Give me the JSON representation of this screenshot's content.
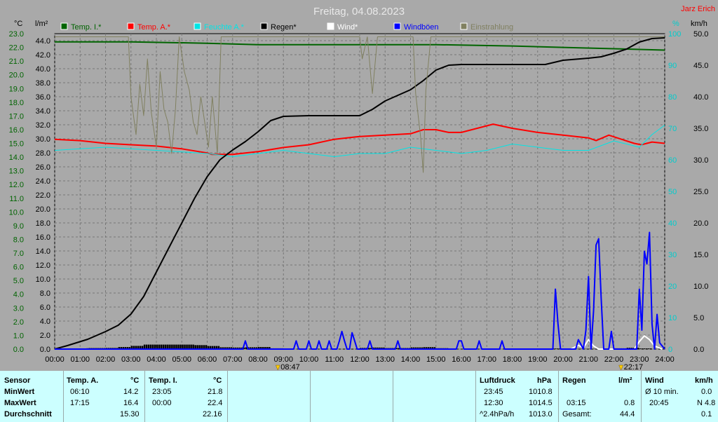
{
  "title": "Freitag, 04.08.2023",
  "author": "Jarz Erich",
  "units": {
    "left_temp": "°C",
    "left_rain": "l/m²",
    "right_hum": "%",
    "right_wind": "km/h"
  },
  "legend": [
    {
      "label": "Temp. I.*",
      "color": "#006400"
    },
    {
      "label": "Temp. A.*",
      "color": "#ff0000"
    },
    {
      "label": "Feuchte A.*",
      "color": "#00e5e5"
    },
    {
      "label": "Regen*",
      "color": "#000000"
    },
    {
      "label": "Wind*",
      "color": "#ffffff"
    },
    {
      "label": "Windböen",
      "color": "#0000ff"
    },
    {
      "label": "Einstrahlung",
      "color": "#808060"
    }
  ],
  "markers": [
    {
      "label": "08:47",
      "time": 8.78
    },
    {
      "label": "22:17",
      "time": 22.28
    }
  ],
  "chart_data": {
    "type": "line",
    "title": "Freitag, 04.08.2023",
    "x_ticks": [
      "00:00",
      "01:00",
      "02:00",
      "03:00",
      "04:00",
      "05:00",
      "06:00",
      "07:00",
      "08:00",
      "09:00",
      "10:00",
      "11:00",
      "12:00",
      "13:00",
      "14:00",
      "15:00",
      "16:00",
      "17:00",
      "18:00",
      "19:00",
      "20:00",
      "21:00",
      "22:00",
      "23:00",
      "24:00"
    ],
    "xlim": [
      0,
      24
    ],
    "axes": {
      "temp": {
        "label": "°C",
        "lim": [
          0,
          23
        ],
        "ticks": [
          "0.0",
          "1.0",
          "2.0",
          "3.0",
          "4.0",
          "5.0",
          "6.0",
          "7.0",
          "8.0",
          "9.0",
          "10.0",
          "11.0",
          "12.0",
          "13.0",
          "14.0",
          "15.0",
          "16.0",
          "17.0",
          "18.0",
          "19.0",
          "20.0",
          "21.0",
          "22.0",
          "23.0"
        ]
      },
      "rain": {
        "label": "l/m²",
        "lim": [
          0,
          45
        ],
        "ticks": [
          "0.0",
          "2.0",
          "4.0",
          "6.0",
          "8.0",
          "10.0",
          "12.0",
          "14.0",
          "16.0",
          "18.0",
          "20.0",
          "22.0",
          "24.0",
          "26.0",
          "28.0",
          "30.0",
          "32.0",
          "34.0",
          "36.0",
          "38.0",
          "40.0",
          "42.0",
          "44.0"
        ]
      },
      "hum": {
        "label": "%",
        "lim": [
          0,
          100
        ],
        "ticks": [
          "0",
          "10",
          "20",
          "30",
          "40",
          "50",
          "60",
          "70",
          "80",
          "90",
          "100"
        ]
      },
      "wind": {
        "label": "km/h",
        "lim": [
          0,
          50
        ],
        "ticks": [
          "0.0",
          "5.0",
          "10.0",
          "15.0",
          "20.0",
          "25.0",
          "30.0",
          "35.0",
          "40.0",
          "45.0",
          "50.0"
        ]
      }
    },
    "series": [
      {
        "name": "Temp. I.*",
        "axis": "temp",
        "color": "#006400",
        "width": 2,
        "points": [
          [
            0,
            22.4
          ],
          [
            3,
            22.4
          ],
          [
            6,
            22.3
          ],
          [
            8,
            22.2
          ],
          [
            12,
            22.2
          ],
          [
            15,
            22.2
          ],
          [
            18,
            22.1
          ],
          [
            20,
            22.0
          ],
          [
            22,
            21.9
          ],
          [
            24,
            21.8
          ]
        ]
      },
      {
        "name": "Temp. A.*",
        "axis": "temp",
        "color": "#ff0000",
        "width": 2,
        "points": [
          [
            0,
            15.3
          ],
          [
            1,
            15.2
          ],
          [
            2,
            15.0
          ],
          [
            3,
            14.9
          ],
          [
            4,
            14.8
          ],
          [
            5,
            14.6
          ],
          [
            6,
            14.3
          ],
          [
            6.17,
            14.2
          ],
          [
            7,
            14.2
          ],
          [
            8,
            14.4
          ],
          [
            9,
            14.7
          ],
          [
            10,
            14.9
          ],
          [
            11,
            15.3
          ],
          [
            12,
            15.5
          ],
          [
            13,
            15.6
          ],
          [
            14,
            15.7
          ],
          [
            14.5,
            16.0
          ],
          [
            15,
            16.0
          ],
          [
            15.5,
            15.8
          ],
          [
            16,
            15.8
          ],
          [
            17.25,
            16.4
          ],
          [
            18,
            16.1
          ],
          [
            19,
            15.8
          ],
          [
            20,
            15.6
          ],
          [
            20.5,
            15.5
          ],
          [
            21,
            15.4
          ],
          [
            21.3,
            15.2
          ],
          [
            21.8,
            15.6
          ],
          [
            22.3,
            15.3
          ],
          [
            22.8,
            15.0
          ],
          [
            23.08,
            14.9
          ],
          [
            23.5,
            15.1
          ],
          [
            24,
            15.0
          ]
        ]
      },
      {
        "name": "Feuchte A.*",
        "axis": "hum",
        "color": "#00e5e5",
        "width": 1,
        "points": [
          [
            0,
            63
          ],
          [
            2,
            64
          ],
          [
            4,
            63
          ],
          [
            6,
            62
          ],
          [
            7,
            61
          ],
          [
            8,
            62
          ],
          [
            9,
            63
          ],
          [
            10,
            62
          ],
          [
            11,
            61
          ],
          [
            12,
            62
          ],
          [
            13,
            62
          ],
          [
            14,
            64
          ],
          [
            15,
            63
          ],
          [
            16,
            62
          ],
          [
            17,
            63
          ],
          [
            18,
            65
          ],
          [
            19,
            64
          ],
          [
            20,
            63
          ],
          [
            21,
            63
          ],
          [
            22,
            66
          ],
          [
            23,
            64
          ],
          [
            23.5,
            68
          ],
          [
            24,
            71
          ]
        ]
      },
      {
        "name": "Regen*",
        "axis": "rain",
        "color": "#000000",
        "width": 2,
        "points": [
          [
            0,
            0
          ],
          [
            0.5,
            0.5
          ],
          [
            1.3,
            1.4
          ],
          [
            2,
            2.5
          ],
          [
            2.5,
            3.4
          ],
          [
            3,
            5
          ],
          [
            3.5,
            7.5
          ],
          [
            4,
            11
          ],
          [
            4.5,
            14.5
          ],
          [
            5,
            18
          ],
          [
            5.5,
            21.5
          ],
          [
            6,
            24.6
          ],
          [
            6.5,
            27
          ],
          [
            7,
            28.4
          ],
          [
            7.5,
            29.6
          ],
          [
            8,
            31
          ],
          [
            8.5,
            32.6
          ],
          [
            9,
            33.2
          ],
          [
            10,
            33.3
          ],
          [
            11,
            33.3
          ],
          [
            12,
            33.3
          ],
          [
            12.5,
            34.2
          ],
          [
            13,
            35.4
          ],
          [
            13.5,
            36.2
          ],
          [
            14,
            37
          ],
          [
            14.5,
            38.3
          ],
          [
            15,
            39.8
          ],
          [
            15.5,
            40.5
          ],
          [
            16,
            40.6
          ],
          [
            18,
            40.6
          ],
          [
            19.3,
            40.6
          ],
          [
            20,
            41.2
          ],
          [
            21,
            41.5
          ],
          [
            21.5,
            41.7
          ],
          [
            22,
            42.2
          ],
          [
            22.5,
            42.8
          ],
          [
            23,
            43.8
          ],
          [
            23.5,
            44.3
          ],
          [
            24,
            44.4
          ]
        ]
      },
      {
        "name": "Wind*",
        "axis": "wind",
        "color": "#ffffff",
        "width": 2,
        "points": [
          [
            20.3,
            0
          ],
          [
            20.6,
            0.6
          ],
          [
            20.8,
            0.2
          ],
          [
            21.0,
            1.5
          ],
          [
            21.2,
            0.5
          ],
          [
            21.4,
            0
          ],
          [
            22.8,
            0
          ],
          [
            23.0,
            1.2
          ],
          [
            23.2,
            2.1
          ],
          [
            23.4,
            1.5
          ],
          [
            23.6,
            0.5
          ],
          [
            23.9,
            0
          ]
        ]
      },
      {
        "name": "Windböen",
        "axis": "wind",
        "color": "#0000ff",
        "width": 2,
        "points": [
          [
            0,
            0
          ],
          [
            7.4,
            0
          ],
          [
            7.5,
            1.3
          ],
          [
            7.6,
            0
          ],
          [
            9.4,
            0
          ],
          [
            9.5,
            1.3
          ],
          [
            9.6,
            0
          ],
          [
            9.9,
            0
          ],
          [
            10,
            1.3
          ],
          [
            10.1,
            0
          ],
          [
            10.3,
            0
          ],
          [
            10.4,
            1.3
          ],
          [
            10.5,
            0
          ],
          [
            10.7,
            0
          ],
          [
            10.8,
            1.3
          ],
          [
            10.9,
            0
          ],
          [
            11.1,
            0
          ],
          [
            11.2,
            1.3
          ],
          [
            11.3,
            2.8
          ],
          [
            11.4,
            1.3
          ],
          [
            11.5,
            0
          ],
          [
            11.6,
            0
          ],
          [
            11.7,
            2.6
          ],
          [
            11.8,
            1.3
          ],
          [
            11.9,
            0
          ],
          [
            12.3,
            0
          ],
          [
            12.4,
            1.3
          ],
          [
            12.5,
            0
          ],
          [
            13.4,
            0
          ],
          [
            13.5,
            1.3
          ],
          [
            13.6,
            0
          ],
          [
            15.8,
            0
          ],
          [
            15.9,
            1.3
          ],
          [
            16.0,
            1.3
          ],
          [
            16.1,
            0
          ],
          [
            16.6,
            0
          ],
          [
            16.7,
            1.3
          ],
          [
            16.8,
            0
          ],
          [
            17.5,
            0
          ],
          [
            17.6,
            1.3
          ],
          [
            17.7,
            0
          ],
          [
            19.6,
            0
          ],
          [
            19.7,
            9.5
          ],
          [
            19.8,
            4
          ],
          [
            19.9,
            0
          ],
          [
            20.5,
            0
          ],
          [
            20.6,
            1.5
          ],
          [
            20.8,
            0
          ],
          [
            20.9,
            3
          ],
          [
            21.0,
            11.5
          ],
          [
            21.1,
            0
          ],
          [
            21.2,
            6
          ],
          [
            21.3,
            16.5
          ],
          [
            21.4,
            17.5
          ],
          [
            21.5,
            8
          ],
          [
            21.6,
            0
          ],
          [
            21.8,
            0
          ],
          [
            21.9,
            2.8
          ],
          [
            22.0,
            0
          ],
          [
            22.9,
            0
          ],
          [
            23.0,
            9.5
          ],
          [
            23.1,
            3
          ],
          [
            23.2,
            15.5
          ],
          [
            23.3,
            13.5
          ],
          [
            23.4,
            18.5
          ],
          [
            23.5,
            4
          ],
          [
            23.6,
            0
          ],
          [
            23.7,
            5.5
          ],
          [
            23.8,
            1
          ],
          [
            24,
            0
          ]
        ]
      },
      {
        "name": "Einstrahlung",
        "axis": "hum",
        "color": "#808060",
        "width": 1,
        "points": [
          [
            0,
            99
          ],
          [
            2,
            99
          ],
          [
            2.9,
            99
          ],
          [
            3,
            80
          ],
          [
            3.2,
            68
          ],
          [
            3.35,
            84
          ],
          [
            3.5,
            74
          ],
          [
            3.65,
            92
          ],
          [
            3.8,
            75
          ],
          [
            4,
            64
          ],
          [
            4.15,
            88
          ],
          [
            4.3,
            76
          ],
          [
            4.45,
            72
          ],
          [
            4.6,
            62
          ],
          [
            4.75,
            76
          ],
          [
            4.9,
            99
          ],
          [
            5.1,
            88
          ],
          [
            5.3,
            82
          ],
          [
            5.45,
            72
          ],
          [
            5.6,
            68
          ],
          [
            5.75,
            80
          ],
          [
            5.9,
            72
          ],
          [
            6.05,
            64
          ],
          [
            6.2,
            80
          ],
          [
            6.4,
            62
          ],
          [
            6.55,
            99
          ],
          [
            6.7,
            99
          ],
          [
            12,
            99
          ],
          [
            12.1,
            92
          ],
          [
            12.3,
            99
          ],
          [
            12.5,
            81
          ],
          [
            12.7,
            99
          ],
          [
            13,
            99
          ],
          [
            14.1,
            99
          ],
          [
            14.2,
            81
          ],
          [
            14.4,
            67
          ],
          [
            14.5,
            56
          ],
          [
            14.6,
            82
          ],
          [
            14.8,
            99
          ],
          [
            16,
            99
          ],
          [
            18,
            99
          ],
          [
            22,
            99
          ],
          [
            24,
            99
          ]
        ]
      }
    ],
    "rain_bars_axis": "rain"
  },
  "stats": {
    "headers": {
      "sensor": "Sensor",
      "temp_a": "Temp. A.",
      "temp_a_unit": "°C",
      "temp_i": "Temp. I.",
      "temp_i_unit": "°C",
      "pressure": "Luftdruck",
      "pressure_unit": "hPa",
      "rain": "Regen",
      "rain_unit": "l/m²",
      "wind": "Wind",
      "wind_unit": "km/h"
    },
    "rows": {
      "min": "MinWert",
      "max": "MaxWert",
      "avg": "Durchschnitt"
    },
    "temp_a": {
      "min_time": "06:10",
      "min_val": "14.2",
      "max_time": "17:15",
      "max_val": "16.4",
      "avg": "15.30"
    },
    "temp_i": {
      "min_time": "23:05",
      "min_val": "21.8",
      "max_time": "00:00",
      "max_val": "22.4",
      "avg": "22.16"
    },
    "pressure": {
      "r1_time": "23:45",
      "r1_val": "1010.8",
      "r2_time": "12:30",
      "r2_val": "1014.5",
      "r3_label": "^2.4hPa/h",
      "r3_val": "1013.0"
    },
    "rain": {
      "r2_time": "03:15",
      "r2_val": "0.8",
      "r3_label": "Gesamt:",
      "r3_val": "44.4"
    },
    "wind": {
      "r1_label": "Ø 10 min.",
      "r1_val": "0.0",
      "r2_time": "20:45",
      "r2_val": "N 4.8",
      "r3_val": "0.1"
    }
  }
}
